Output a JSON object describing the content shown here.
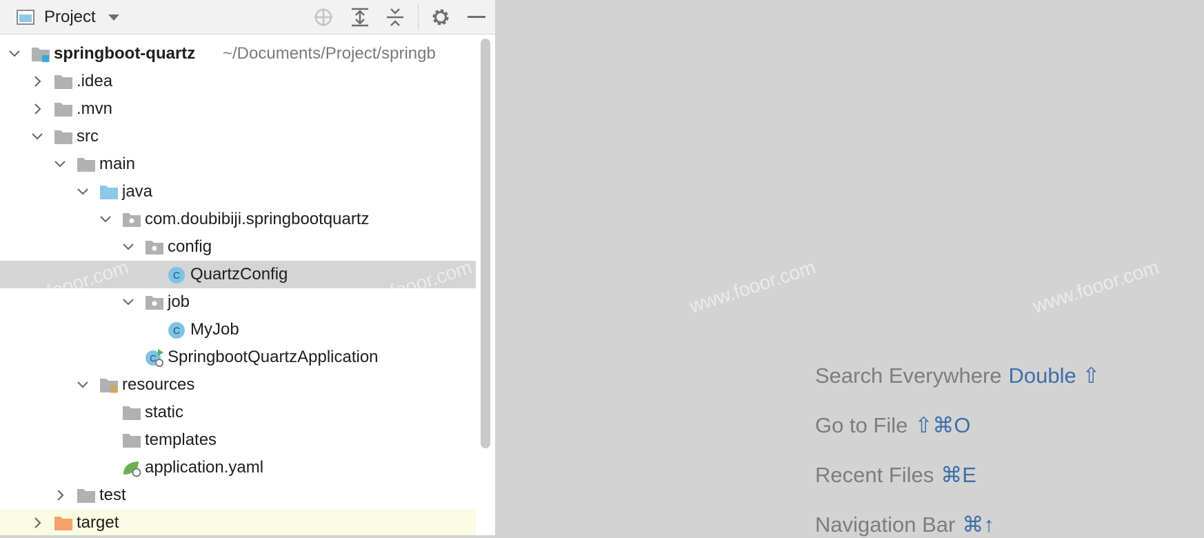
{
  "panel": {
    "title": "Project",
    "toolbar_icons": [
      "locate-icon",
      "expand-all-icon",
      "collapse-all-icon",
      "gear-icon",
      "minimize-icon"
    ]
  },
  "tree": [
    {
      "label": "springboot-quartz",
      "path": "~/Documents/Project/springb",
      "icon": "module",
      "indent": 0,
      "expanded": true,
      "bold": true
    },
    {
      "label": ".idea",
      "icon": "folder",
      "indent": 1,
      "expanded": false
    },
    {
      "label": ".mvn",
      "icon": "folder",
      "indent": 1,
      "expanded": false
    },
    {
      "label": "src",
      "icon": "folder",
      "indent": 1,
      "expanded": true
    },
    {
      "label": "main",
      "icon": "folder",
      "indent": 2,
      "expanded": true
    },
    {
      "label": "java",
      "icon": "source-folder",
      "indent": 3,
      "expanded": true
    },
    {
      "label": "com.doubibiji.springbootquartz",
      "icon": "package",
      "indent": 4,
      "expanded": true
    },
    {
      "label": "config",
      "icon": "package",
      "indent": 5,
      "expanded": true
    },
    {
      "label": "QuartzConfig",
      "icon": "class",
      "indent": 6,
      "selected": true
    },
    {
      "label": "job",
      "icon": "package",
      "indent": 5,
      "expanded": true
    },
    {
      "label": "MyJob",
      "icon": "class",
      "indent": 6
    },
    {
      "label": "SpringbootQuartzApplication",
      "icon": "spring-app-class",
      "indent": 5
    },
    {
      "label": "resources",
      "icon": "resources-folder",
      "indent": 3,
      "expanded": true
    },
    {
      "label": "static",
      "icon": "folder",
      "indent": 4
    },
    {
      "label": "templates",
      "icon": "folder",
      "indent": 4
    },
    {
      "label": "application.yaml",
      "icon": "spring-config",
      "indent": 4
    },
    {
      "label": "test",
      "icon": "folder",
      "indent": 2,
      "expanded": false
    },
    {
      "label": "target",
      "icon": "excluded-folder",
      "indent": 1,
      "expanded": false,
      "excluded": true
    }
  ],
  "editor": {
    "hints": [
      {
        "text": "Search Everywhere",
        "shortcut": "Double ⇧"
      },
      {
        "text": "Go to File",
        "shortcut": "⇧⌘O"
      },
      {
        "text": "Recent Files",
        "shortcut": "⌘E"
      },
      {
        "text": "Navigation Bar",
        "shortcut": "⌘↑"
      }
    ]
  },
  "watermark": "www.fooor.com",
  "colors": {
    "folder": "#afb1b3",
    "source_folder": "#8cc8ea",
    "excluded_folder": "#f4a26a",
    "class_icon": "#7ec3e6",
    "shortcut": "#3d6fa8",
    "selection": "#d5d5d5"
  }
}
